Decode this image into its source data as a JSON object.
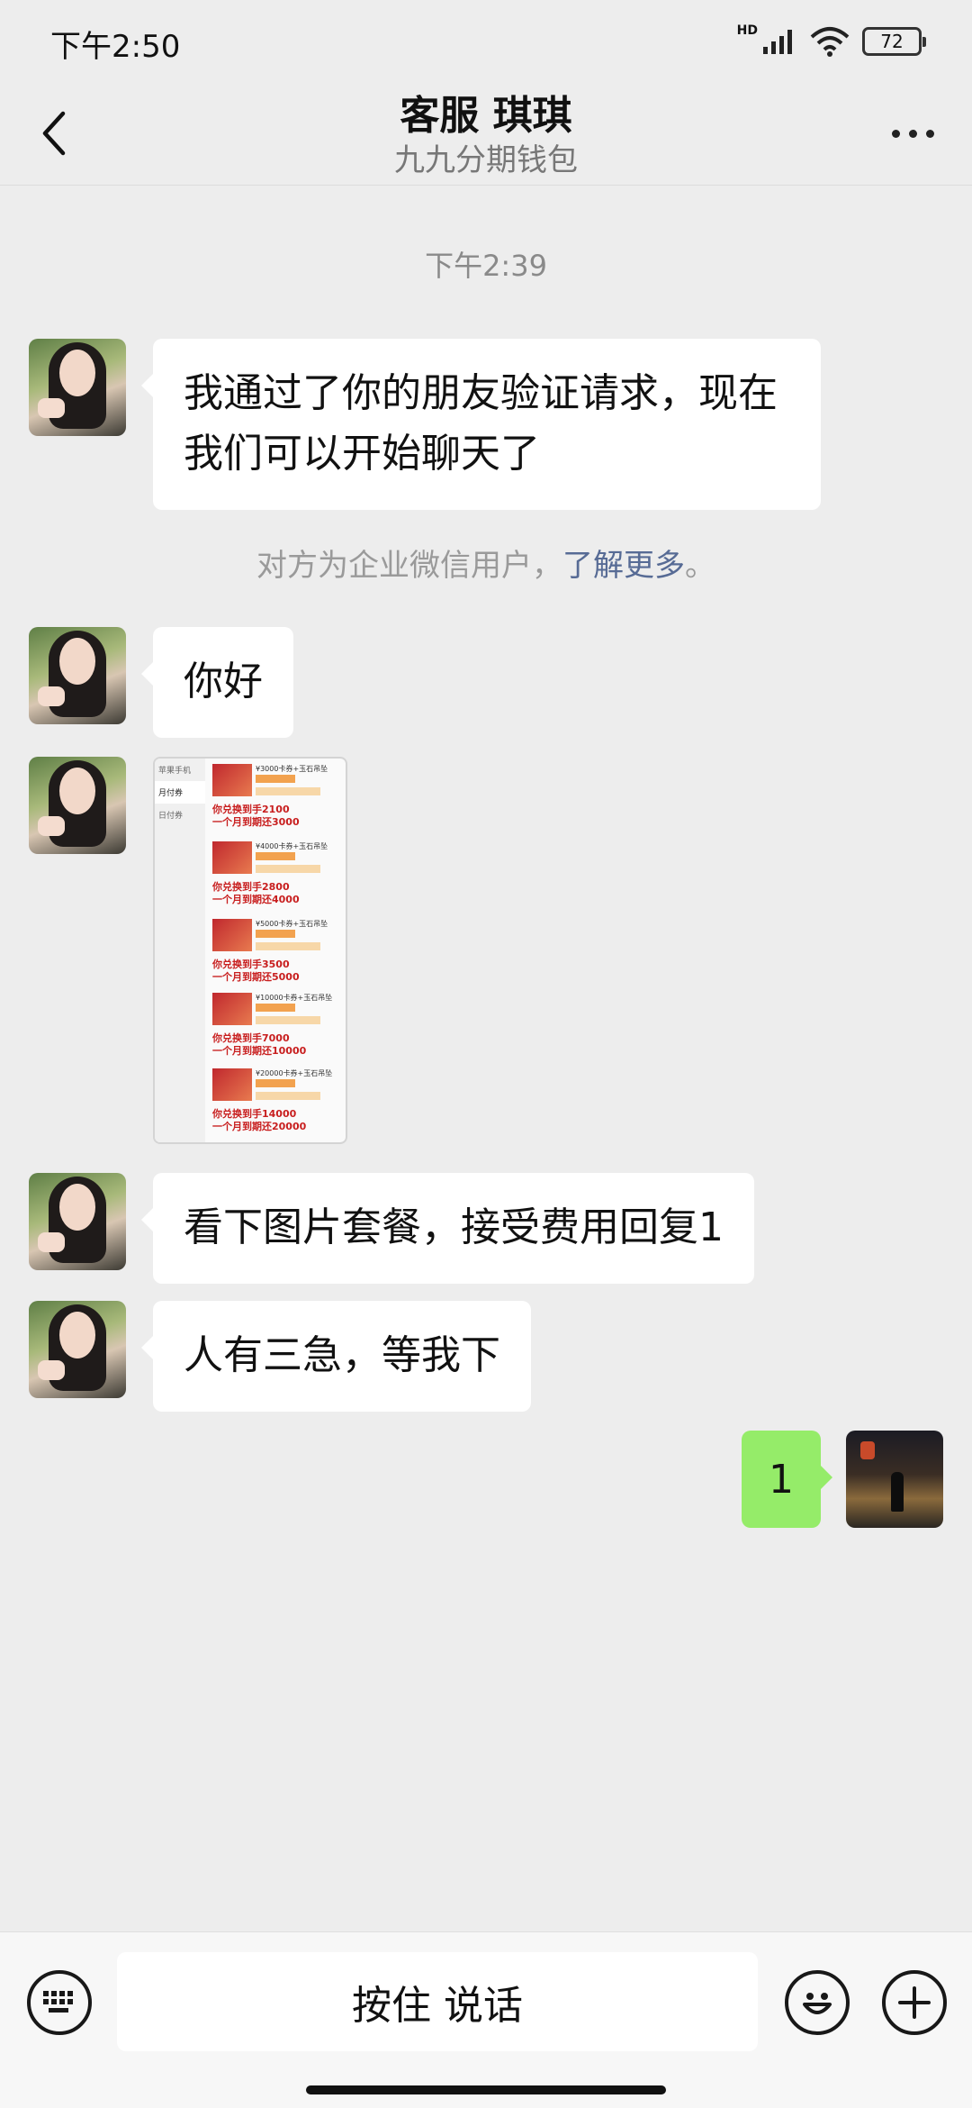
{
  "status_bar": {
    "time": "下午2:50",
    "network_label": "HD",
    "battery": "72"
  },
  "header": {
    "title": "客服 琪琪",
    "subtitle": "九九分期钱包",
    "back_icon": "chevron-left-icon",
    "more_icon": "more-dots-icon"
  },
  "chat": {
    "timestamp": "下午2:39",
    "system_note": {
      "text": "对方为企业微信用户，",
      "link": "了解更多",
      "suffix": "。"
    },
    "messages": [
      {
        "from": "other",
        "text": "我通过了你的朋友验证请求，现在我们可以开始聊天了"
      },
      {
        "from": "other",
        "text": "你好"
      },
      {
        "from": "other",
        "text": "看下图片套餐，接受费用回复1"
      },
      {
        "from": "other",
        "text": "人有三急，等我下"
      },
      {
        "from": "self",
        "text": "1"
      }
    ],
    "image_message": {
      "sidebar": [
        "苹果手机",
        "月付券",
        "日付券"
      ],
      "plans": [
        {
          "title": "¥3000卡券+玉石吊坠",
          "line1": "你兑换到手2100",
          "line2": "一个月到期还3000"
        },
        {
          "title": "¥4000卡券+玉石吊坠",
          "line1": "你兑换到手2800",
          "line2": "一个月到期还4000"
        },
        {
          "title": "¥5000卡券+玉石吊坠",
          "line1": "你兑换到手3500",
          "line2": "一个月到期还5000"
        },
        {
          "title": "¥10000卡券+玉石吊坠",
          "line1": "你兑换到手7000",
          "line2": "一个月到期还10000"
        },
        {
          "title": "¥20000卡券+玉石吊坠",
          "line1": "你兑换到手14000",
          "line2": "一个月到期还20000"
        }
      ]
    }
  },
  "input_bar": {
    "voice_label": "按住 说话",
    "left_icon": "keyboard-icon",
    "emoji_icon": "emoji-icon",
    "plus_icon": "plus-icon"
  },
  "colors": {
    "background": "#ededed",
    "self_bubble": "#95ec69",
    "other_bubble": "#ffffff",
    "link": "#576b95"
  }
}
